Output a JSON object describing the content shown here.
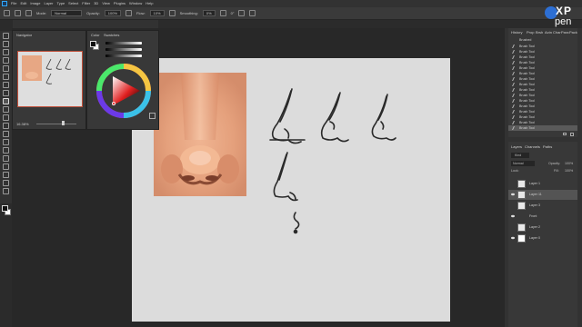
{
  "menubar": {
    "items": [
      "File",
      "Edit",
      "Image",
      "Layer",
      "Type",
      "Select",
      "Filter",
      "3D",
      "View",
      "Plugins",
      "Window",
      "Help"
    ]
  },
  "options": {
    "mode_label": "Mode:",
    "mode_value": "Normal",
    "opacity_label": "Opacity:",
    "opacity_value": "100%",
    "flow_label": "Flow:",
    "flow_value": "10%",
    "smoothing_label": "Smoothing:",
    "smoothing_value": "0%",
    "angle_value": "0°"
  },
  "navigator": {
    "title": "Navigator",
    "zoom": "16.38%"
  },
  "color_panel": {
    "tab_color": "Color",
    "tab_swatches": "Swatches"
  },
  "history": {
    "tabs": [
      "History",
      "Prop",
      "Brsh",
      "Actn",
      "Char",
      "Para",
      "Pack"
    ],
    "brush_item": "Brush Tool",
    "items_count_label": "Brushed",
    "items": [
      "Brushed",
      "Brush Tool",
      "Brush Tool",
      "Brush Tool",
      "Brush Tool",
      "Brush Tool",
      "Brush Tool",
      "Brush Tool",
      "Brush Tool",
      "Brush Tool",
      "Brush Tool",
      "Brush Tool",
      "Brush Tool",
      "Brush Tool",
      "Brush Tool",
      "Brush Tool",
      "Brush Tool"
    ]
  },
  "layers": {
    "tabs": [
      "Layers",
      "Channels",
      "Paths"
    ],
    "kind_label": "Kind",
    "blend_mode": "Normal",
    "opacity_label": "Opacity:",
    "opacity_value": "100%",
    "lock_label": "Lock:",
    "fill_label": "Fill:",
    "fill_value": "100%",
    "rows": [
      {
        "name": "Layer 1",
        "visible": false,
        "selected": false
      },
      {
        "name": "Layer 11",
        "visible": true,
        "selected": true
      },
      {
        "name": "Layer 3",
        "visible": false,
        "selected": false
      },
      {
        "name": "Front",
        "visible": true,
        "selected": false
      },
      {
        "name": "Layer 2",
        "visible": false,
        "selected": false
      },
      {
        "name": "Layer 0",
        "visible": true,
        "selected": false
      }
    ]
  },
  "brand": {
    "top": "XP",
    "bottom": "pen"
  },
  "colors": {
    "skin": "#e9a581",
    "canvas": "#dcdcdc",
    "accent_blue": "#31a8ff"
  }
}
